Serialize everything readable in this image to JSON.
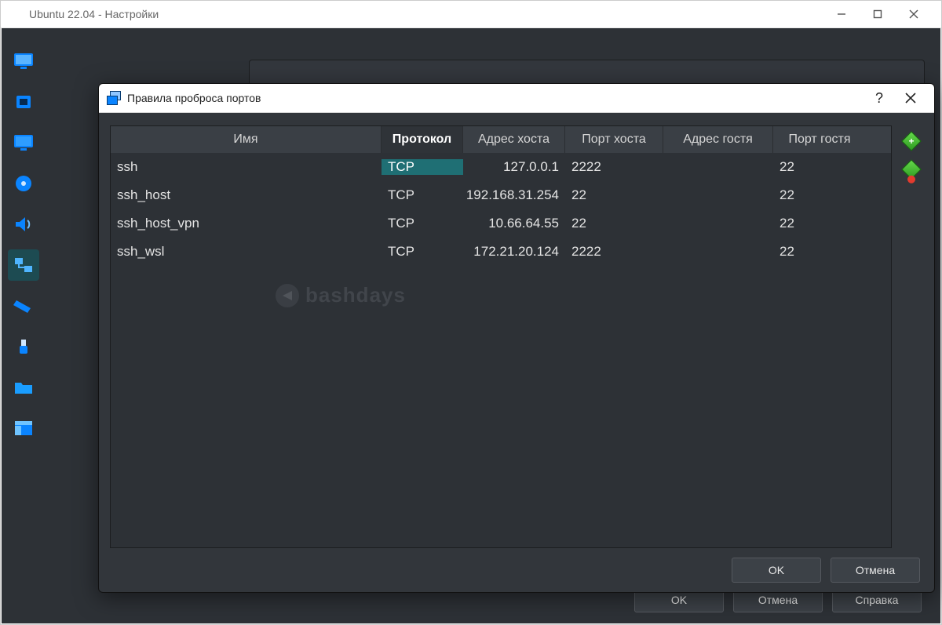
{
  "parent_window": {
    "title": "Ubuntu 22.04 - Настройки",
    "buttons": {
      "ok": "OK",
      "cancel": "Отмена",
      "help": "Справка"
    }
  },
  "sidebar": {
    "items": [
      {
        "id": "general",
        "name": "general"
      },
      {
        "id": "system",
        "name": "system"
      },
      {
        "id": "display",
        "name": "display"
      },
      {
        "id": "storage",
        "name": "storage"
      },
      {
        "id": "audio",
        "name": "audio"
      },
      {
        "id": "network",
        "name": "network",
        "active": true
      },
      {
        "id": "serial",
        "name": "serial"
      },
      {
        "id": "usb",
        "name": "usb"
      },
      {
        "id": "shared",
        "name": "shared-folders"
      },
      {
        "id": "ui",
        "name": "user-interface"
      }
    ]
  },
  "dialog": {
    "title": "Правила проброса портов",
    "help": "?",
    "columns": {
      "name": "Имя",
      "protocol": "Протокол",
      "host_addr": "Адрес хоста",
      "host_port": "Порт хоста",
      "guest_addr": "Адрес гостя",
      "guest_port": "Порт гостя"
    },
    "sorted_column": "protocol",
    "rows": [
      {
        "name": "ssh",
        "protocol": "TCP",
        "host_addr": "127.0.0.1",
        "host_port": "2222",
        "guest_addr": "",
        "guest_port": "22",
        "protocol_selected": true
      },
      {
        "name": "ssh_host",
        "protocol": "TCP",
        "host_addr": "192.168.31.254",
        "host_port": "22",
        "guest_addr": "",
        "guest_port": "22"
      },
      {
        "name": "ssh_host_vpn",
        "protocol": "TCP",
        "host_addr": "10.66.64.55",
        "host_port": "22",
        "guest_addr": "",
        "guest_port": "22"
      },
      {
        "name": "ssh_wsl",
        "protocol": "TCP",
        "host_addr": "172.21.20.124",
        "host_port": "2222",
        "guest_addr": "",
        "guest_port": "22"
      }
    ],
    "buttons": {
      "ok": "OK",
      "cancel": "Отмена"
    }
  },
  "watermark": "bashdays"
}
